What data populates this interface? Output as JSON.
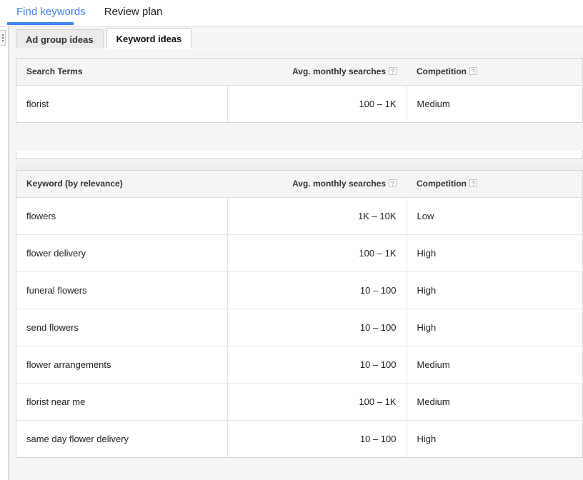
{
  "topnav": {
    "tabs": [
      {
        "label": "Find keywords",
        "active": true
      },
      {
        "label": "Review plan",
        "active": false
      }
    ],
    "accent_color": "#4285f4"
  },
  "left_rail": {
    "collapse_handle_name": "panel-collapse-handle"
  },
  "subtabs": [
    {
      "label": "Ad group ideas",
      "active": false
    },
    {
      "label": "Keyword ideas",
      "active": true
    }
  ],
  "help_icon_glyph": "?",
  "tables": [
    {
      "id": "search-terms",
      "columns": [
        {
          "label": "Search Terms",
          "help": false
        },
        {
          "label": "Avg. monthly searches",
          "help": true
        },
        {
          "label": "Competition",
          "help": true
        }
      ],
      "rows": [
        {
          "term": "florist",
          "searches": "100 – 1K",
          "competition": "Medium"
        }
      ]
    },
    {
      "id": "keyword-ideas",
      "columns": [
        {
          "label": "Keyword (by relevance)",
          "help": false
        },
        {
          "label": "Avg. monthly searches",
          "help": true
        },
        {
          "label": "Competition",
          "help": true
        }
      ],
      "rows": [
        {
          "term": "flowers",
          "searches": "1K – 10K",
          "competition": "Low"
        },
        {
          "term": "flower delivery",
          "searches": "100 – 1K",
          "competition": "High"
        },
        {
          "term": "funeral flowers",
          "searches": "10 – 100",
          "competition": "High"
        },
        {
          "term": "send flowers",
          "searches": "10 – 100",
          "competition": "High"
        },
        {
          "term": "flower arrangements",
          "searches": "10 – 100",
          "competition": "Medium"
        },
        {
          "term": "florist near me",
          "searches": "100 – 1K",
          "competition": "Medium"
        },
        {
          "term": "same day flower delivery",
          "searches": "10 – 100",
          "competition": "High"
        }
      ]
    }
  ]
}
